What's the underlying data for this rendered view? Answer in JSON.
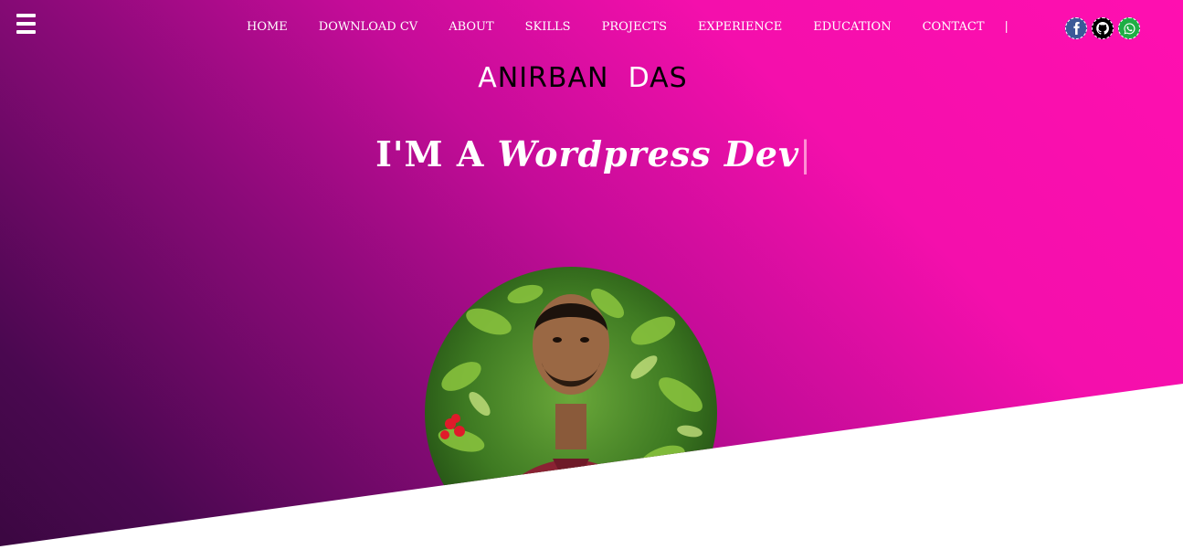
{
  "nav": {
    "items": [
      "HOME",
      "DOWNLOAD CV",
      "ABOUT",
      "SKILLS",
      "PROJECTS",
      "EXPERIENCE",
      "EDUCATION",
      "CONTACT"
    ],
    "separator": "|"
  },
  "brand": {
    "first_initial": "A",
    "first_rest": "NIRBAN",
    "last_initial": "D",
    "last_rest": "AS"
  },
  "hero": {
    "tagline_prefix": "I'M A",
    "tagline_role": "Wordpress Dev",
    "cursor": "|"
  },
  "socials": [
    {
      "icon": "facebook-icon",
      "color": "#3b5998"
    },
    {
      "icon": "github-icon",
      "color": "#000000"
    },
    {
      "icon": "whatsapp-icon",
      "color": "#1fae45"
    }
  ],
  "colors": {
    "gradient_start": "#ff0fb0",
    "gradient_end": "#3a0740",
    "text": "#ffffff"
  }
}
